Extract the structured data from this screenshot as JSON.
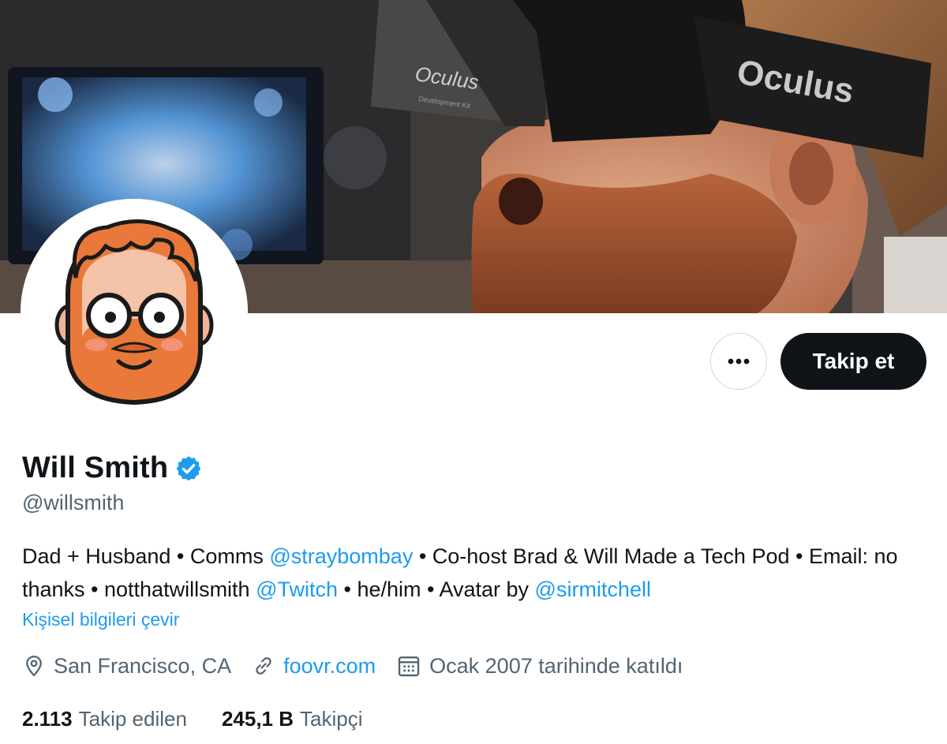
{
  "banner": {
    "headset_brand_strap": "Oculus",
    "headset_brand_front": "Oculus",
    "headset_sub_text": "Development Kit"
  },
  "actions": {
    "more_icon": "ellipsis-icon",
    "follow_label": "Takip et"
  },
  "profile": {
    "name": "Will Smith",
    "verified_icon": "verified-badge-icon",
    "handle": "@willsmith",
    "bio": {
      "t1": "Dad + Husband • Comms ",
      "m1": "@straybombay",
      "t2": " • Co-host Brad & Will Made a Tech Pod • Email: no thanks • notthatwillsmith ",
      "m2": "@Twitch",
      "t3": " • he/him • Avatar by ",
      "m3": "@sirmitchell"
    },
    "translate_label": "Kişisel bilgileri çevir",
    "location": "San Francisco, CA",
    "website": "foovr.com",
    "joined": "Ocak 2007 tarihinde katıldı"
  },
  "stats": {
    "following_count": "2.113",
    "following_label": "Takip edilen",
    "followers_count": "245,1 B",
    "followers_label": "Takipçi"
  },
  "colors": {
    "accent": "#1d9bf0",
    "text": "#0f1419",
    "secondary": "#536471",
    "button_bg": "#0f1419"
  }
}
